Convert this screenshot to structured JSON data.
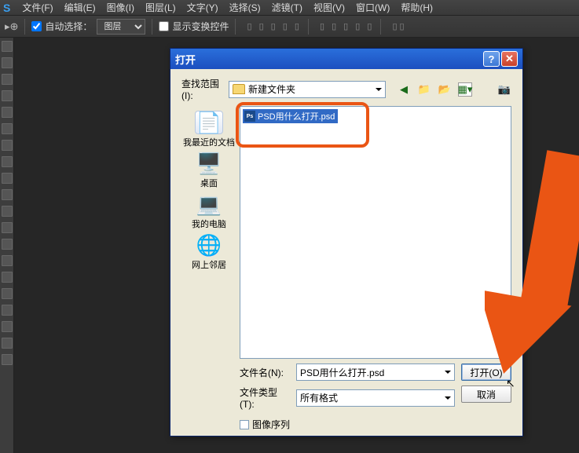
{
  "app": {
    "logo": "S"
  },
  "menu": {
    "file": "文件(F)",
    "edit": "编辑(E)",
    "image": "图像(I)",
    "layer": "图层(L)",
    "type": "文字(Y)",
    "select": "选择(S)",
    "filter": "滤镜(T)",
    "view": "视图(V)",
    "window": "窗口(W)",
    "help": "帮助(H)"
  },
  "toolbar": {
    "auto_select": "自动选择：",
    "auto_select_mode": "图层",
    "show_transform": "显示变换控件"
  },
  "dialog": {
    "title": "打开",
    "lookin_label": "查找范围(I):",
    "lookin_value": "新建文件夹",
    "sidebar": {
      "recent": "我最近的文档",
      "desktop": "桌面",
      "my_computer": "我的电脑",
      "network": "网上邻居"
    },
    "file_item": "PSD用什么打开.psd",
    "filename_label": "文件名(N):",
    "filename_value": "PSD用什么打开.psd",
    "filetype_label": "文件类型(T):",
    "filetype_value": "所有格式",
    "open_btn": "打开(O)",
    "cancel_btn": "取消",
    "image_sequence": "图像序列"
  }
}
